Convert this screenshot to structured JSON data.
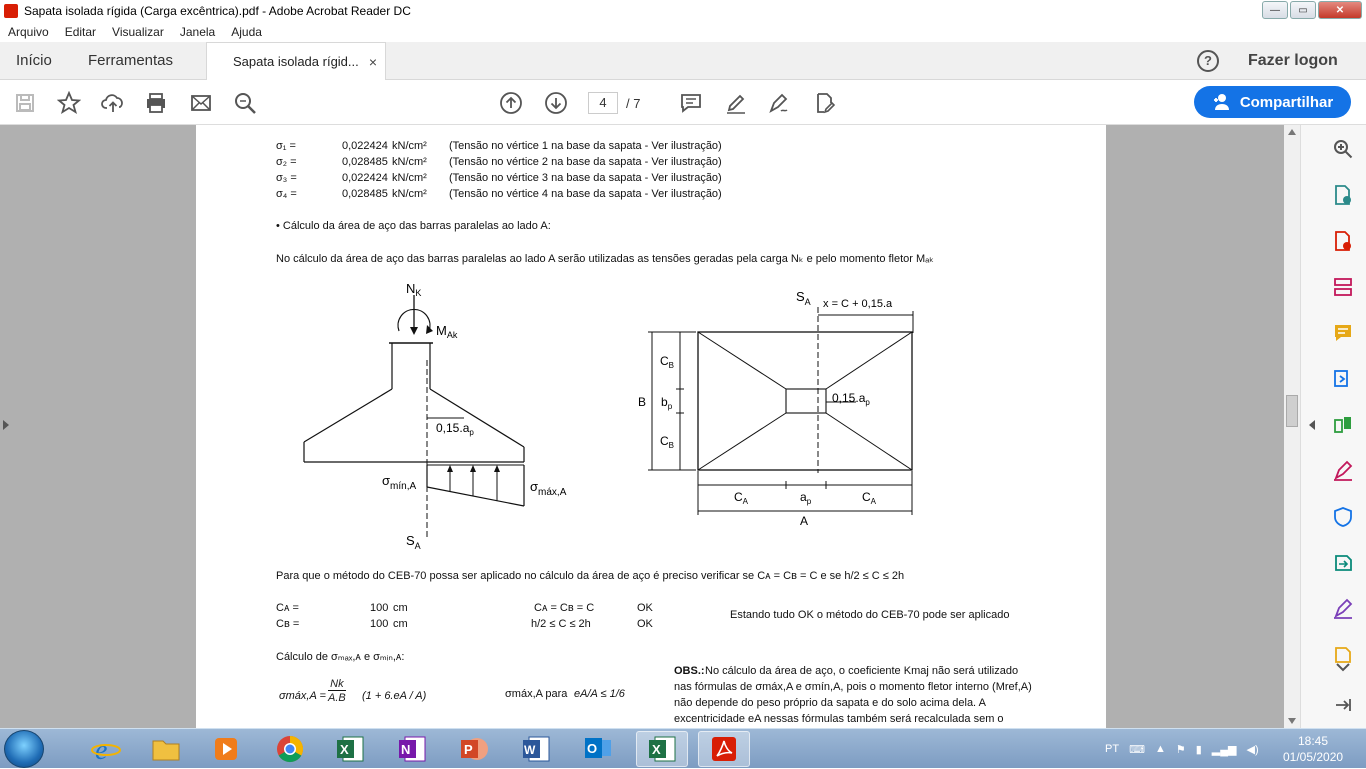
{
  "window": {
    "title": "Sapata isolada rígida (Carga excêntrica).pdf - Adobe Acrobat Reader DC",
    "buttons": {
      "minimize": "—",
      "maximize": "▭",
      "close": "✕"
    }
  },
  "menu": [
    "Arquivo",
    "Editar",
    "Visualizar",
    "Janela",
    "Ajuda"
  ],
  "tabs": {
    "home": "Início",
    "tools": "Ferramentas",
    "document": "Sapata isolada rígid...",
    "close": "×",
    "help": "?",
    "login": "Fazer logon"
  },
  "toolbar": {
    "page_current": "4",
    "page_total": "/ 7",
    "share_label": "Compartilhar",
    "icons": [
      "save-icon",
      "star-icon",
      "upload-icon",
      "print-icon",
      "mail-icon",
      "search-icon",
      "page-up-icon",
      "page-down-icon",
      "comment-icon",
      "highlight-icon",
      "sign-icon",
      "edit-icon"
    ]
  },
  "doc": {
    "stress_rows": [
      {
        "sym": "σ₁ =",
        "val": "0,022424",
        "unit": "kN/cm²",
        "desc": "(Tensão no vértice 1 na base da sapata - Ver ilustração)"
      },
      {
        "sym": "σ₂ =",
        "val": "0,028485",
        "unit": "kN/cm²",
        "desc": "(Tensão no vértice 2 na base da sapata - Ver ilustração)"
      },
      {
        "sym": "σ₃ =",
        "val": "0,022424",
        "unit": "kN/cm²",
        "desc": "(Tensão no vértice 3 na base da sapata - Ver ilustração)"
      },
      {
        "sym": "σ₄ =",
        "val": "0,028485",
        "unit": "kN/cm²",
        "desc": "(Tensão no vértice 4 na base da sapata - Ver ilustração)"
      }
    ],
    "bullet": "• Cálculo da área de aço das barras paralelas ao lado A:",
    "intro": "No cálculo da área de aço das barras paralelas ao lado A serão utilizadas as tensões geradas pela carga Nₖ e pelo momento fletor Mₐₖ",
    "fig1": {
      "nk": "N",
      "nk_sub": "K",
      "mak": "M",
      "mak_sub": "Ak",
      "offset": "0,15.a",
      "offset_sub": "p",
      "smin": "σ",
      "smin_sub": "mín,A",
      "smax": "σ",
      "smax_sub": "máx,A",
      "sa": "S",
      "sa_sub": "A"
    },
    "fig2": {
      "sa": "S",
      "sa_sub": "A",
      "xa": "x",
      "xa_eq": "= C",
      "xa_tail": "+ 0,15.a",
      "cb": "C",
      "cb_sub": "B",
      "b": "B",
      "bp": "b",
      "bp_sub": "p",
      "offset": "0,15.a",
      "offset_sub": "p",
      "ca": "C",
      "ca_sub": "A",
      "ap": "a",
      "ap_sub": "p",
      "a": "A"
    },
    "cond_text": "Para que o método do CEB-70 possa ser aplicado no cálculo da área de aço é preciso verificar se Cᴀ = Cʙ = C e se h/2 ≤ C ≤ 2h",
    "checks": [
      {
        "sym": "Cᴀ =",
        "val": "100",
        "unit": "cm",
        "cond": "Cᴀ = Cʙ = C",
        "res": "OK"
      },
      {
        "sym": "Cʙ =",
        "val": "100",
        "unit": "cm",
        "cond": "h/2 ≤ C ≤ 2h",
        "res": "OK"
      }
    ],
    "ok_note": "Estando tudo OK o método do CEB-70 pode ser aplicado",
    "calc_title": "Cálculo de σₘₐₓ,ᴀ e σₘᵢₙ,ᴀ:",
    "formula_lhs": "σmáx,A =",
    "formula_frac_num": "Nk",
    "formula_frac_den": "A.B",
    "formula_par": "(1 + 6.eA / A)",
    "formula_rhs_label": "σmáx,A  para",
    "formula_rhs_cond": "eA/A ≤ 1/6",
    "obs_bold": "OBS.:",
    "obs_lines": [
      "No cálculo da área de aço, o coeficiente Kmaj não será utilizado",
      "nas fórmulas de σmáx,A e σmín,A, pois o momento fletor interno (Mref,A)",
      "não depende do peso próprio da sapata e do solo acima dela. A",
      "excentricidade eA nessas fórmulas também será recalculada sem o"
    ]
  },
  "taskbar": {
    "lang": "PT",
    "time": "18:45",
    "date": "01/05/2020",
    "apps": [
      "ie-icon",
      "explorer-icon",
      "media-icon",
      "chrome-icon",
      "excel-icon",
      "onenote-icon",
      "powerpoint-icon",
      "word-icon",
      "outlook-icon",
      "excel-active-icon",
      "acrobat-icon"
    ]
  },
  "colors": {
    "accent": "#1473e6",
    "acrobat": "#d81e05",
    "right_icons": [
      "#555555",
      "#2b8a8a",
      "#d81e05",
      "#c2185b",
      "#e6a817",
      "#1473e6",
      "#2e9d3f",
      "#c2185b",
      "#1473e6",
      "#0a8a7a",
      "#7b3fb8",
      "#e6a817"
    ]
  }
}
